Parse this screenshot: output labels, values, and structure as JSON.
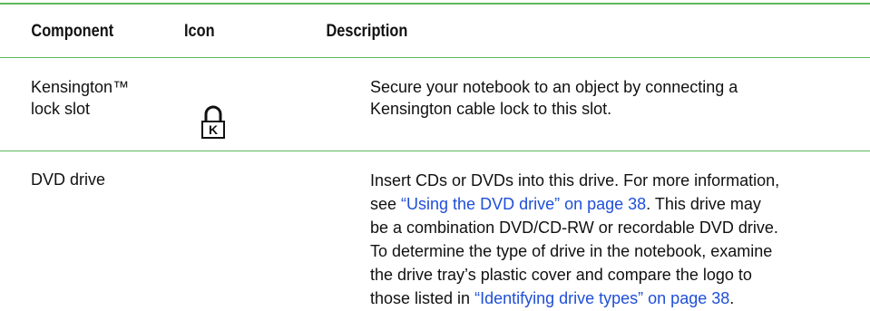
{
  "table": {
    "headers": {
      "component": "Component",
      "icon": "Icon",
      "description": "Description"
    },
    "rows": [
      {
        "component_lines": [
          "Kensington™",
          "lock slot"
        ],
        "icon": "kensington-lock-icon",
        "icon_letter": "K",
        "description_lines": [
          "Secure your notebook to an object by connecting a",
          "Kensington cable lock to this slot."
        ]
      },
      {
        "component_lines": [
          "DVD drive"
        ],
        "icon": "",
        "description": {
          "l1": "Insert CDs or DVDs into this drive. For more information,",
          "l2_pre": "see ",
          "l2_link": "“Using the DVD drive” on page 38",
          "l2_post": ". This drive may",
          "l3": "be a combination DVD/CD-RW or recordable DVD drive.",
          "l4": "To determine the type of drive in the notebook, examine",
          "l5": "the drive tray’s plastic cover and compare the logo to",
          "l6_pre": "those listed in ",
          "l6_link": "“Identifying drive types” on page 38",
          "l6_post": "."
        }
      }
    ]
  },
  "colors": {
    "rule": "#5cb85c",
    "link": "#1f4fd8",
    "text": "#111111"
  }
}
